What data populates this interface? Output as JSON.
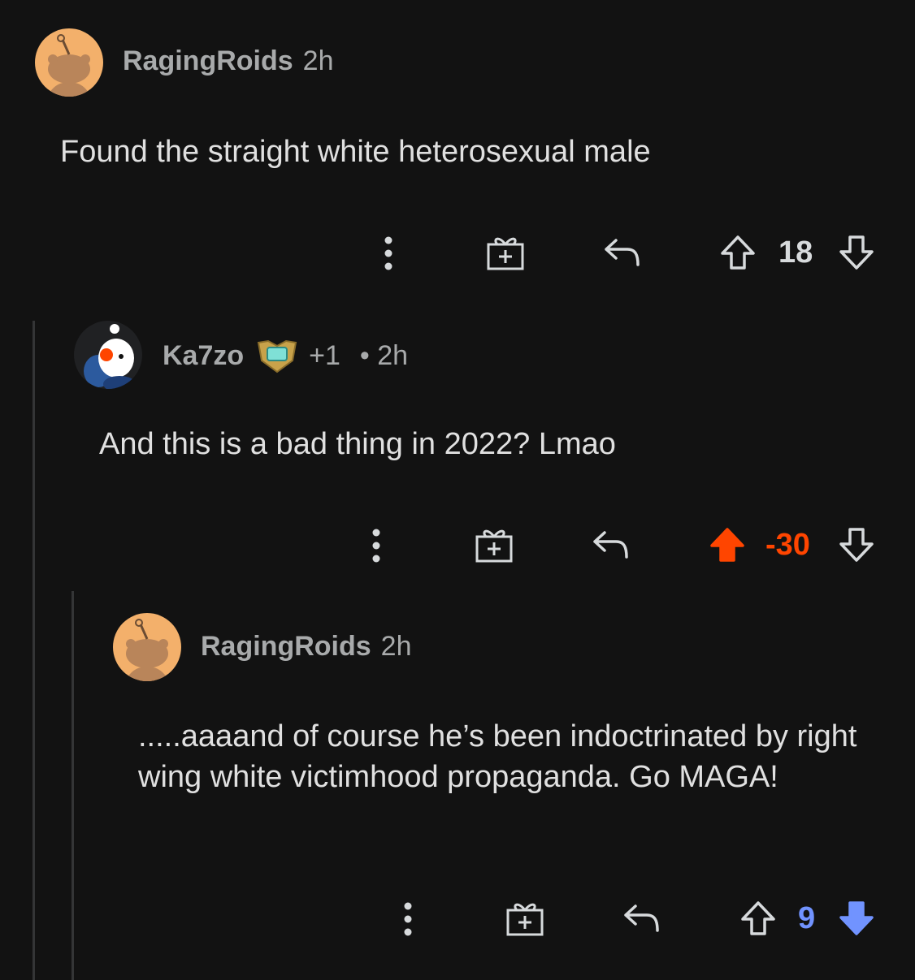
{
  "comments": [
    {
      "username": "RagingRoids",
      "time": "2h",
      "body": "Found the straight white heterosexual male",
      "score": "18",
      "vote_state": "none"
    },
    {
      "username": "Ka7zo",
      "flair_extra": "+1",
      "time": "• 2h",
      "body": "And this is a bad thing in 2022? Lmao",
      "score": "-30",
      "vote_state": "upvoted"
    },
    {
      "username": "RagingRoids",
      "time": "2h",
      "body": ".....aaaand of course he’s been indoctrinated by right wing white victimhood propaganda. Go MAGA!",
      "score": "9",
      "vote_state": "downvoted"
    }
  ],
  "icons": {
    "more": "more-options-icon",
    "award": "award-icon",
    "reply": "reply-icon",
    "upvote": "upvote-icon",
    "downvote": "downvote-icon"
  },
  "colors": {
    "background": "#121212",
    "upvote": "#ff4500",
    "downvote": "#7193ff",
    "thread_line": "#343536",
    "avatar_bg": "#f3b06b"
  }
}
